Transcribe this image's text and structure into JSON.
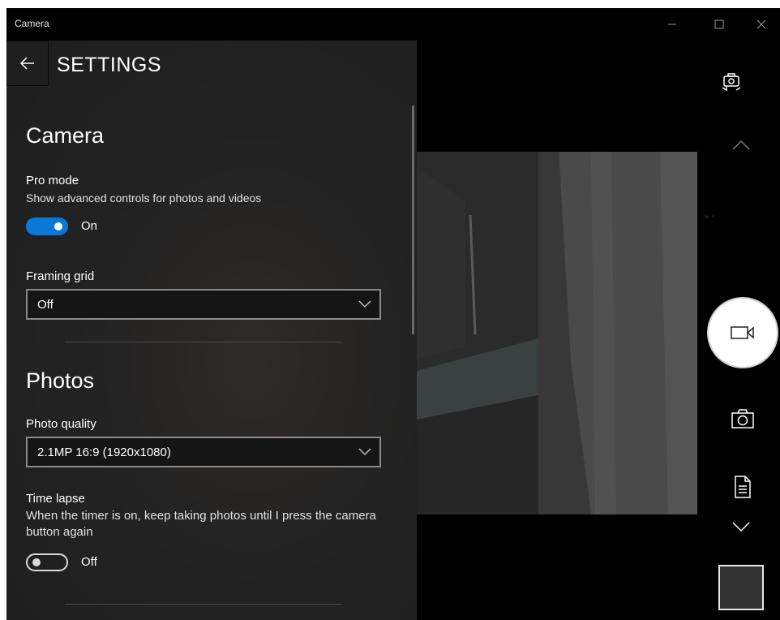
{
  "window": {
    "title": "Camera"
  },
  "settings": {
    "title": "SETTINGS",
    "camera_section": {
      "heading": "Camera",
      "pro_mode": {
        "label": "Pro mode",
        "description": "Show advanced controls for photos and videos",
        "state": "On"
      },
      "framing_grid": {
        "label": "Framing grid",
        "value": "Off"
      }
    },
    "photos_section": {
      "heading": "Photos",
      "photo_quality": {
        "label": "Photo quality",
        "value": "2.1MP 16:9 (1920x1080)"
      },
      "time_lapse": {
        "label": "Time lapse",
        "description": "When the timer is on, keep taking photos until I press the camera button again",
        "state": "Off"
      }
    }
  },
  "colors": {
    "accent": "#0a78d7",
    "panel_bg": "#232323",
    "window_bg": "#000000"
  },
  "icons": {
    "back": "arrow-left-icon",
    "switch_camera": "switch-camera-icon",
    "up": "chevron-up-icon",
    "video": "video-camera-icon",
    "photo": "camera-icon",
    "document": "document-scan-icon",
    "down": "chevron-down-icon"
  }
}
